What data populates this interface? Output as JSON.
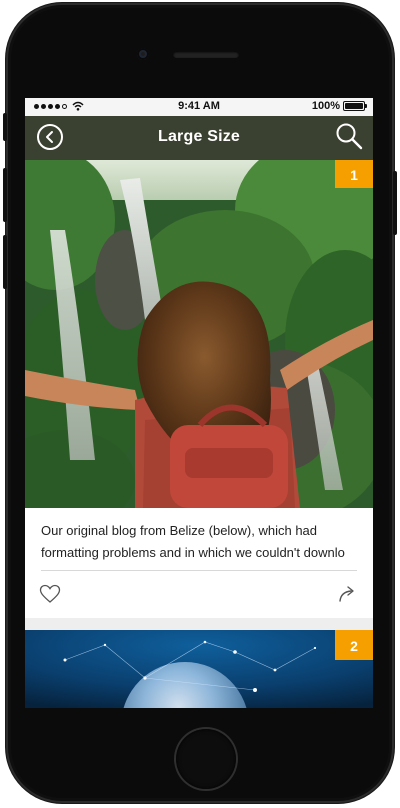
{
  "status_bar": {
    "time": "9:41 AM",
    "battery": "100%"
  },
  "nav": {
    "title": "Large Size"
  },
  "cards": [
    {
      "badge": "1",
      "text_line1": "Our original blog from Belize (below), which had",
      "text_line2": "formatting problems and in which we couldn't downlo"
    },
    {
      "badge": "2"
    }
  ],
  "colors": {
    "navbar": "#3b4130",
    "badge": "#f5a000",
    "statusbar": "#f5f5f5"
  },
  "icons": {
    "back": "circle-chevron-left-icon",
    "search": "magnifier-icon",
    "like": "heart-outline-icon",
    "share": "share-arrow-icon"
  }
}
